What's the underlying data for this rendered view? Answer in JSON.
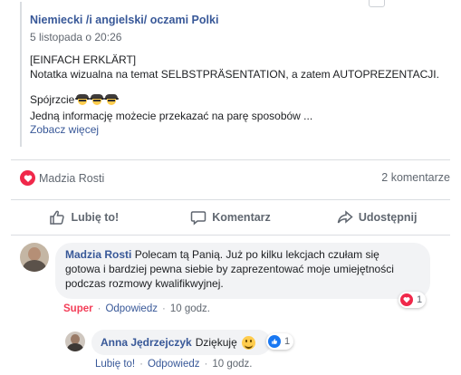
{
  "shared_post": {
    "author": "Niemiecki /i angielski/ oczami Polki",
    "time": "5 listopada o 20:26",
    "line1": "[EINFACH ERKLÄRT]",
    "line2": "Notatka wizualna na temat SELBSTPRÄSENTATION, a zatem AUTOPREZENTACJI.",
    "line3": "Spójrzcie",
    "line4": "Jedną informację możecie przekazać na parę sposobów ...",
    "see_more": "Zobacz więcej",
    "menu_glyph": "···"
  },
  "reactions": {
    "names": "Madzia Rosti",
    "comments_count": "2 komentarze",
    "reaction_type": "heart-icon",
    "heart_color": "#f0284a"
  },
  "actions": {
    "like": "Lubię to!",
    "comment": "Komentarz",
    "share": "Udostępnij"
  },
  "comments": [
    {
      "author": "Madzia Rosti",
      "line1": "Polecam tą Panią. Już po kilku lekcjach czułam się",
      "line2": "gotowa i bardziej pewna siebie by zaprezentować moje umiejętności",
      "line3": "podczas rozmowy kwalifikwyjnej.",
      "reaction_count": "1",
      "reacted_label": "Super",
      "reply_label": "Odpowiedz",
      "time": "10 godz."
    },
    {
      "author": "Anna Jędrzejczyk",
      "text": "Dziękuję",
      "reaction_count": "1",
      "like_label": "Lubię to!",
      "reply_label": "Odpowiedz",
      "time": "10 godz."
    }
  ],
  "colors": {
    "link": "#385898",
    "muted": "#606770",
    "super": "#f33e58",
    "like_blue": "#1877f2",
    "bubble": "#f2f3f5"
  }
}
